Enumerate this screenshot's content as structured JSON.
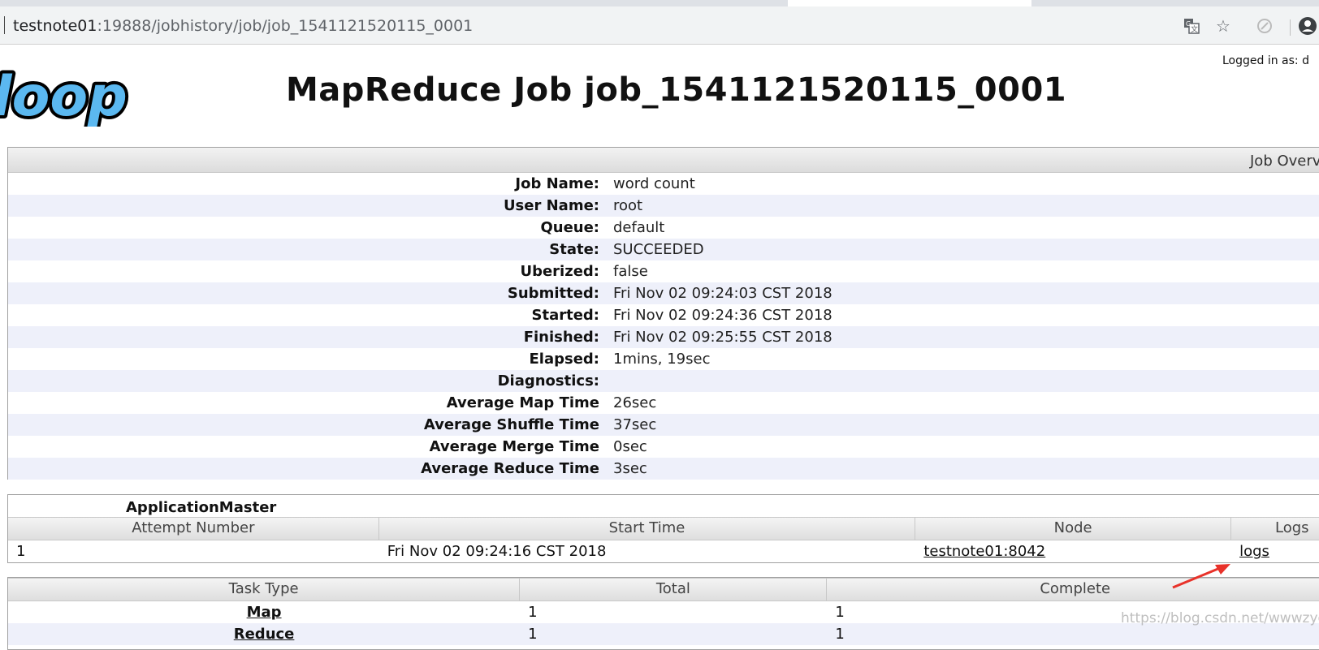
{
  "browser": {
    "url_host": "testnote01",
    "url_path": ":19888/jobhistory/job/job_1541121520115_0001",
    "icons": [
      "translate-icon",
      "star-icon",
      "extension-icon",
      "profile-icon"
    ]
  },
  "header": {
    "logged_in": "Logged in as: d",
    "logo_text": "doop",
    "title": "MapReduce Job job_1541121520115_0001"
  },
  "overview": {
    "heading": "Job Overv",
    "rows": [
      {
        "key": "Job Name:",
        "value": "word count"
      },
      {
        "key": "User Name:",
        "value": "root"
      },
      {
        "key": "Queue:",
        "value": "default"
      },
      {
        "key": "State:",
        "value": "SUCCEEDED"
      },
      {
        "key": "Uberized:",
        "value": "false"
      },
      {
        "key": "Submitted:",
        "value": "Fri Nov 02 09:24:03 CST 2018"
      },
      {
        "key": "Started:",
        "value": "Fri Nov 02 09:24:36 CST 2018"
      },
      {
        "key": "Finished:",
        "value": "Fri Nov 02 09:25:55 CST 2018"
      },
      {
        "key": "Elapsed:",
        "value": "1mins, 19sec"
      },
      {
        "key": "Diagnostics:",
        "value": ""
      },
      {
        "key": "Average Map Time",
        "value": "26sec"
      },
      {
        "key": "Average Shuffle Time",
        "value": "37sec"
      },
      {
        "key": "Average Merge Time",
        "value": "0sec"
      },
      {
        "key": "Average Reduce Time",
        "value": "3sec"
      }
    ]
  },
  "app_master": {
    "title": "ApplicationMaster",
    "headers": [
      "Attempt Number",
      "Start Time",
      "Node",
      "Logs"
    ],
    "row": {
      "attempt": "1",
      "start_time": "Fri Nov 02 09:24:16 CST 2018",
      "node": "testnote01:8042",
      "logs": "logs"
    }
  },
  "tasks": {
    "headers": [
      "Task Type",
      "Total",
      "Complete"
    ],
    "rows": [
      {
        "type": "Map",
        "total": "1",
        "complete": "1"
      },
      {
        "type": "Reduce",
        "total": "1",
        "complete": "1"
      }
    ]
  },
  "watermark": "https://blog.csdn.net/wwwzydcom",
  "colors": {
    "alt_row": "#eef0fa",
    "annotation_arrow": "#e8322a",
    "logo_blue": "#5bb8f0"
  }
}
